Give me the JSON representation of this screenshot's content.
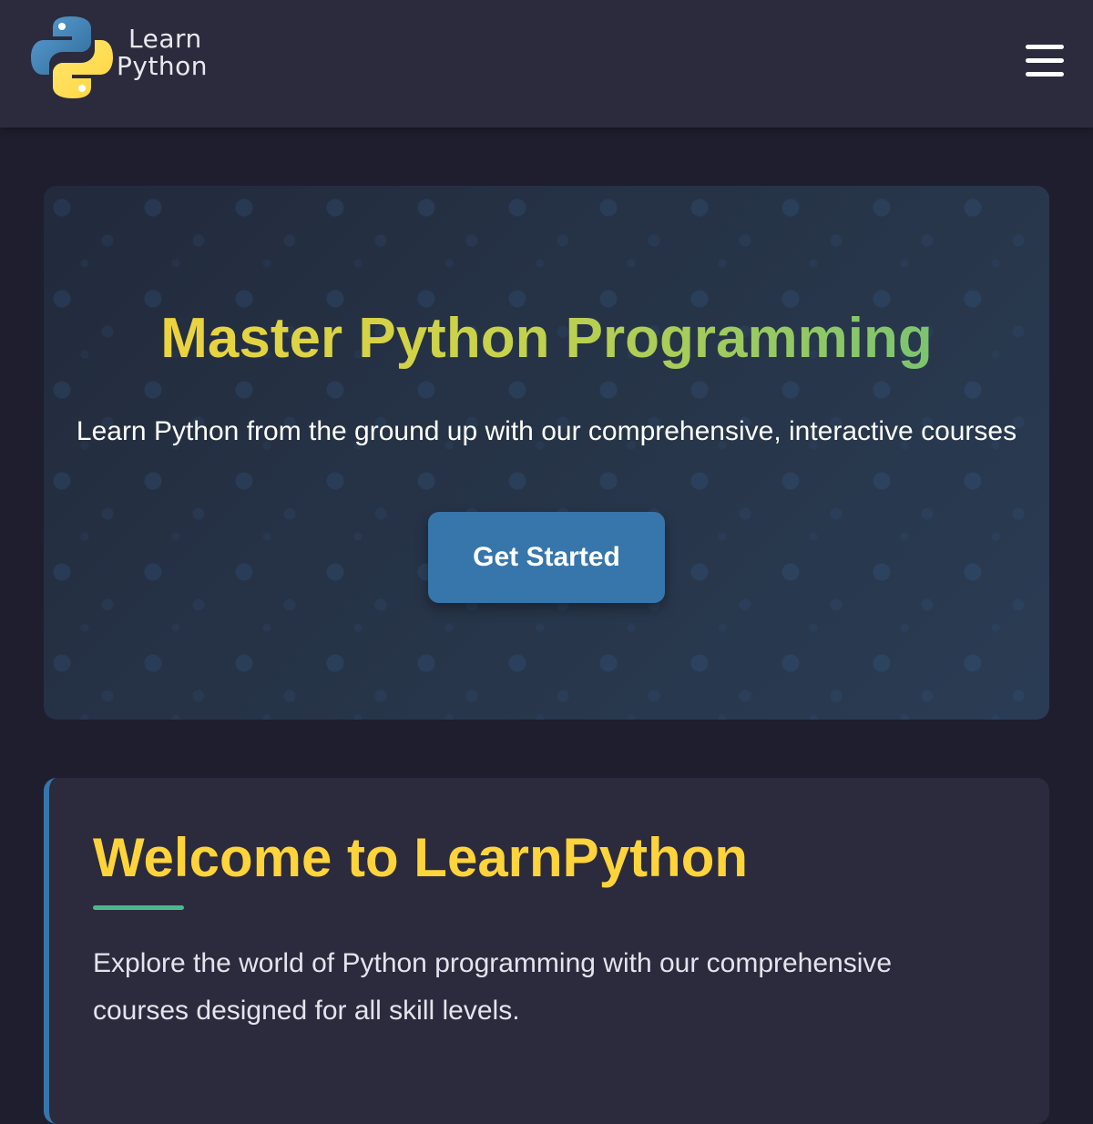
{
  "header": {
    "logo_line1": "Learn",
    "logo_line2": "Python",
    "menu_icon": "hamburger-menu-icon"
  },
  "hero": {
    "title": "Master Python Programming",
    "subtitle": "Learn Python from the ground up with our comprehensive, interactive courses",
    "cta_label": "Get Started"
  },
  "welcome": {
    "title": "Welcome to LearnPython",
    "text": "Explore the world of Python programming with our comprehensive courses designed for all skill levels."
  },
  "colors": {
    "background": "#1e1e2e",
    "header": "#2b2b3d",
    "accent_blue": "#3776ab",
    "accent_yellow": "#ffd43b",
    "accent_green": "#4bb88c"
  }
}
